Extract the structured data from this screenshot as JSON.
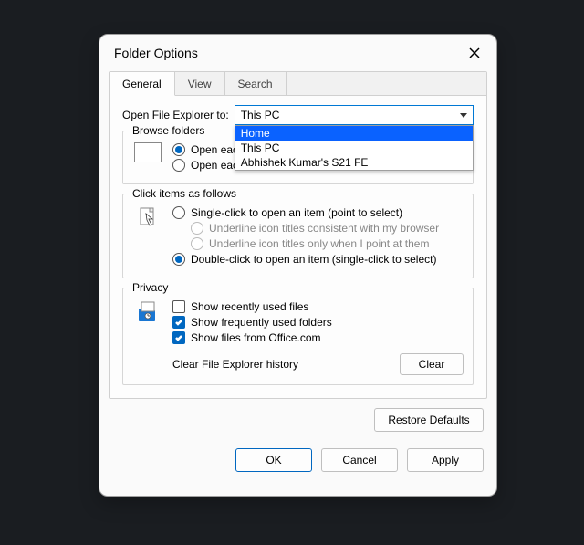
{
  "title": "Folder Options",
  "tabs": [
    "General",
    "View",
    "Search"
  ],
  "open_label": "Open File Explorer to:",
  "open_selected": "This PC",
  "open_options": [
    "Home",
    "This PC",
    "Abhishek Kumar's S21 FE"
  ],
  "browse": {
    "legend": "Browse folders",
    "opt1": "Open each folder in the same window",
    "opt1_trunc": "Open eac",
    "opt2": "Open each folder in its own window"
  },
  "click": {
    "legend": "Click items as follows",
    "single": "Single-click to open an item (point to select)",
    "underline1": "Underline icon titles consistent with my browser",
    "underline2": "Underline icon titles only when I point at them",
    "double": "Double-click to open an item (single-click to select)"
  },
  "privacy": {
    "legend": "Privacy",
    "recent": "Show recently used files",
    "frequent": "Show frequently used folders",
    "office": "Show files from Office.com",
    "clear_label": "Clear File Explorer history",
    "clear_btn": "Clear"
  },
  "restore_btn": "Restore Defaults",
  "buttons": {
    "ok": "OK",
    "cancel": "Cancel",
    "apply": "Apply"
  }
}
